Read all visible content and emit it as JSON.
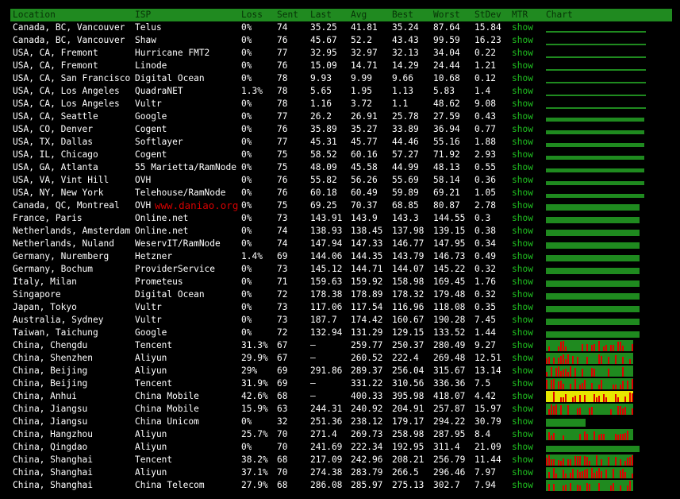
{
  "headers": {
    "location": "Location",
    "isp": "ISP",
    "loss": "Loss",
    "sent": "Sent",
    "last": "Last",
    "avg": "Avg",
    "best": "Best",
    "worst": "Worst",
    "stdev": "StDev",
    "mtr": "MTR",
    "chart": "Chart"
  },
  "watermark": "www.daniao.org",
  "colors": {
    "header_bg": "#208a20",
    "mtr_link": "#20c020",
    "chart_green": "#1f8a1f",
    "loss_red": "#e00000",
    "loss_yellow": "#e6e600"
  },
  "rows": [
    {
      "location": "Canada, BC, Vancouver",
      "isp": "Telus",
      "loss": "0%",
      "sent": "74",
      "last": "35.25",
      "avg": "41.81",
      "best": "35.24",
      "worst": "87.64",
      "stdev": "15.84",
      "mtr": "show",
      "chart": "thin"
    },
    {
      "location": "Canada, BC, Vancouver",
      "isp": "Shaw",
      "loss": "0%",
      "sent": "76",
      "last": "45.67",
      "avg": "52.2",
      "best": "43.43",
      "worst": "99.59",
      "stdev": "16.23",
      "mtr": "show",
      "chart": "thin"
    },
    {
      "location": "USA, CA, Fremont",
      "isp": "Hurricane FMT2",
      "loss": "0%",
      "sent": "77",
      "last": "32.95",
      "avg": "32.97",
      "best": "32.13",
      "worst": "34.04",
      "stdev": "0.22",
      "mtr": "show",
      "chart": "thin"
    },
    {
      "location": "USA, CA, Fremont",
      "isp": "Linode",
      "loss": "0%",
      "sent": "76",
      "last": "15.09",
      "avg": "14.71",
      "best": "14.29",
      "worst": "24.44",
      "stdev": "1.21",
      "mtr": "show",
      "chart": "thin"
    },
    {
      "location": "USA, CA, San Francisco",
      "isp": "Digital Ocean",
      "loss": "0%",
      "sent": "78",
      "last": "9.93",
      "avg": "9.99",
      "best": "9.66",
      "worst": "10.68",
      "stdev": "0.12",
      "mtr": "show",
      "chart": "thin"
    },
    {
      "location": "USA, CA, Los Angeles",
      "isp": "QuadraNET",
      "loss": "1.3%",
      "sent": "78",
      "last": "5.65",
      "avg": "1.95",
      "best": "1.13",
      "worst": "5.83",
      "stdev": "1.4",
      "mtr": "show",
      "chart": "thin"
    },
    {
      "location": "USA, CA, Los Angeles",
      "isp": "Vultr",
      "loss": "0%",
      "sent": "78",
      "last": "1.16",
      "avg": "3.72",
      "best": "1.1",
      "worst": "48.62",
      "stdev": "9.08",
      "mtr": "show",
      "chart": "thin"
    },
    {
      "location": "USA, CA, Seattle",
      "isp": "Google",
      "loss": "0%",
      "sent": "77",
      "last": "26.2",
      "avg": "26.91",
      "best": "25.78",
      "worst": "27.59",
      "stdev": "0.43",
      "mtr": "show",
      "chart": "small"
    },
    {
      "location": "USA, CO, Denver",
      "isp": "Cogent",
      "loss": "0%",
      "sent": "76",
      "last": "35.89",
      "avg": "35.27",
      "best": "33.89",
      "worst": "36.94",
      "stdev": "0.77",
      "mtr": "show",
      "chart": "small"
    },
    {
      "location": "USA, TX, Dallas",
      "isp": "Softlayer",
      "loss": "0%",
      "sent": "77",
      "last": "45.31",
      "avg": "45.77",
      "best": "44.46",
      "worst": "55.16",
      "stdev": "1.88",
      "mtr": "show",
      "chart": "small"
    },
    {
      "location": "USA, IL, Chicago",
      "isp": "Cogent",
      "loss": "0%",
      "sent": "75",
      "last": "58.52",
      "avg": "60.16",
      "best": "57.27",
      "worst": "71.92",
      "stdev": "2.93",
      "mtr": "show",
      "chart": "small"
    },
    {
      "location": "USA, GA, Atlanta",
      "isp": "55 Marietta/RamNode",
      "loss": "0%",
      "sent": "75",
      "last": "48.09",
      "avg": "45.58",
      "best": "44.99",
      "worst": "48.13",
      "stdev": "0.55",
      "mtr": "show",
      "chart": "small"
    },
    {
      "location": "USA, VA, Vint Hill",
      "isp": "OVH",
      "loss": "0%",
      "sent": "76",
      "last": "55.82",
      "avg": "56.26",
      "best": "55.69",
      "worst": "58.14",
      "stdev": "0.36",
      "mtr": "show",
      "chart": "small"
    },
    {
      "location": "USA, NY, New York",
      "isp": "Telehouse/RamNode",
      "loss": "0%",
      "sent": "76",
      "last": "60.18",
      "avg": "60.49",
      "best": "59.89",
      "worst": "69.21",
      "stdev": "1.05",
      "mtr": "show",
      "chart": "small"
    },
    {
      "location": "Canada, QC, Montreal",
      "isp": "OVH",
      "loss": "0%",
      "sent": "75",
      "last": "69.25",
      "avg": "70.37",
      "best": "68.85",
      "worst": "80.87",
      "stdev": "2.78",
      "mtr": "show",
      "chart": "mid"
    },
    {
      "location": "France, Paris",
      "isp": "Online.net",
      "loss": "0%",
      "sent": "73",
      "last": "143.91",
      "avg": "143.9",
      "best": "143.3",
      "worst": "144.55",
      "stdev": "0.3",
      "mtr": "show",
      "chart": "mid"
    },
    {
      "location": "Netherlands, Amsterdam",
      "isp": "Online.net",
      "loss": "0%",
      "sent": "74",
      "last": "138.93",
      "avg": "138.45",
      "best": "137.98",
      "worst": "139.15",
      "stdev": "0.38",
      "mtr": "show",
      "chart": "mid"
    },
    {
      "location": "Netherlands, Nuland",
      "isp": "WeservIT/RamNode",
      "loss": "0%",
      "sent": "74",
      "last": "147.94",
      "avg": "147.33",
      "best": "146.77",
      "worst": "147.95",
      "stdev": "0.34",
      "mtr": "show",
      "chart": "mid"
    },
    {
      "location": "Germany, Nuremberg",
      "isp": "Hetzner",
      "loss": "1.4%",
      "sent": "69",
      "last": "144.06",
      "avg": "144.35",
      "best": "143.79",
      "worst": "146.73",
      "stdev": "0.49",
      "mtr": "show",
      "chart": "mid"
    },
    {
      "location": "Germany, Bochum",
      "isp": "ProviderService",
      "loss": "0%",
      "sent": "73",
      "last": "145.12",
      "avg": "144.71",
      "best": "144.07",
      "worst": "145.22",
      "stdev": "0.32",
      "mtr": "show",
      "chart": "mid"
    },
    {
      "location": "Italy, Milan",
      "isp": "Prometeus",
      "loss": "0%",
      "sent": "71",
      "last": "159.63",
      "avg": "159.92",
      "best": "158.98",
      "worst": "169.45",
      "stdev": "1.76",
      "mtr": "show",
      "chart": "mid"
    },
    {
      "location": "Singapore",
      "isp": "Digital Ocean",
      "loss": "0%",
      "sent": "72",
      "last": "178.38",
      "avg": "178.89",
      "best": "178.32",
      "worst": "179.48",
      "stdev": "0.32",
      "mtr": "show",
      "chart": "mid"
    },
    {
      "location": "Japan, Tokyo",
      "isp": "Vultr",
      "loss": "0%",
      "sent": "73",
      "last": "117.06",
      "avg": "117.54",
      "best": "116.96",
      "worst": "118.08",
      "stdev": "0.35",
      "mtr": "show",
      "chart": "mid"
    },
    {
      "location": "Australia, Sydney",
      "isp": "Vultr",
      "loss": "0%",
      "sent": "73",
      "last": "187.7",
      "avg": "174.42",
      "best": "160.67",
      "worst": "190.28",
      "stdev": "7.45",
      "mtr": "show",
      "chart": "mid"
    },
    {
      "location": "Taiwan, Taichung",
      "isp": "Google",
      "loss": "0%",
      "sent": "72",
      "last": "132.94",
      "avg": "131.29",
      "best": "129.15",
      "worst": "133.52",
      "stdev": "1.44",
      "mtr": "show",
      "chart": "mid"
    },
    {
      "location": "China, Chengdu",
      "isp": "Tencent",
      "loss": "31.3%",
      "sent": "67",
      "last": "–",
      "avg": "259.77",
      "best": "250.37",
      "worst": "280.49",
      "stdev": "9.27",
      "mtr": "show",
      "chart": "loss"
    },
    {
      "location": "China, Shenzhen",
      "isp": "Aliyun",
      "loss": "29.9%",
      "sent": "67",
      "last": "–",
      "avg": "260.52",
      "best": "222.4",
      "worst": "269.48",
      "stdev": "12.51",
      "mtr": "show",
      "chart": "loss"
    },
    {
      "location": "China, Beijing",
      "isp": "Aliyun",
      "loss": "29%",
      "sent": "69",
      "last": "291.86",
      "avg": "289.37",
      "best": "256.04",
      "worst": "315.67",
      "stdev": "13.14",
      "mtr": "show",
      "chart": "loss"
    },
    {
      "location": "China, Beijing",
      "isp": "Tencent",
      "loss": "31.9%",
      "sent": "69",
      "last": "–",
      "avg": "331.22",
      "best": "310.56",
      "worst": "336.36",
      "stdev": "7.5",
      "mtr": "show",
      "chart": "loss"
    },
    {
      "location": "China, Anhui",
      "isp": "China Mobile",
      "loss": "42.6%",
      "sent": "68",
      "last": "–",
      "avg": "400.33",
      "best": "395.98",
      "worst": "418.07",
      "stdev": "4.42",
      "mtr": "show",
      "chart": "yellow"
    },
    {
      "location": "China, Jiangsu",
      "isp": "China Mobile",
      "loss": "15.9%",
      "sent": "63",
      "last": "244.31",
      "avg": "240.92",
      "best": "204.91",
      "worst": "257.87",
      "stdev": "15.97",
      "mtr": "show",
      "chart": "loss"
    },
    {
      "location": "China, Jiangsu",
      "isp": "China Unicom",
      "loss": "0%",
      "sent": "32",
      "last": "251.36",
      "avg": "238.12",
      "best": "179.17",
      "worst": "294.22",
      "stdev": "30.79",
      "mtr": "show",
      "chart": "short"
    },
    {
      "location": "China, Hangzhou",
      "isp": "Aliyun",
      "loss": "25.7%",
      "sent": "70",
      "last": "271.4",
      "avg": "269.73",
      "best": "258.98",
      "worst": "287.95",
      "stdev": "8.4",
      "mtr": "show",
      "chart": "loss"
    },
    {
      "location": "China, Qingdao",
      "isp": "Aliyun",
      "loss": "0%",
      "sent": "70",
      "last": "241.69",
      "avg": "222.34",
      "best": "192.95",
      "worst": "311.4",
      "stdev": "21.09",
      "mtr": "show",
      "chart": "mid"
    },
    {
      "location": "China, Shanghai",
      "isp": "Tencent",
      "loss": "38.2%",
      "sent": "68",
      "last": "217.09",
      "avg": "242.96",
      "best": "208.21",
      "worst": "256.79",
      "stdev": "11.44",
      "mtr": "show",
      "chart": "loss"
    },
    {
      "location": "China, Shanghai",
      "isp": "Aliyun",
      "loss": "37.1%",
      "sent": "70",
      "last": "274.38",
      "avg": "283.79",
      "best": "266.5",
      "worst": "296.46",
      "stdev": "7.97",
      "mtr": "show",
      "chart": "loss"
    },
    {
      "location": "China, Shanghai",
      "isp": "China Telecom",
      "loss": "27.9%",
      "sent": "68",
      "last": "286.08",
      "avg": "285.97",
      "best": "275.13",
      "worst": "302.7",
      "stdev": "7.94",
      "mtr": "show",
      "chart": "loss"
    }
  ]
}
